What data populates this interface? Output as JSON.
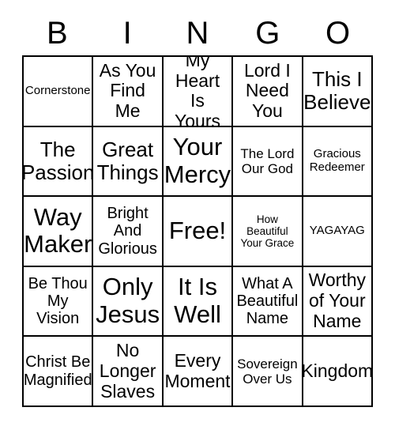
{
  "card": {
    "header_letters": [
      "B",
      "I",
      "N",
      "G",
      "O"
    ],
    "columns": 5,
    "rows": 5,
    "border_color": "#000000",
    "background_color": "#ffffff",
    "text_color": "#000000",
    "free_space": {
      "row": 3,
      "column": 3,
      "label": "Free!"
    },
    "cells": [
      {
        "label": "Cornerstone",
        "size": "xs"
      },
      {
        "label": "As You Find Me",
        "size": "lg"
      },
      {
        "label": "My Heart Is Yours",
        "size": "lg"
      },
      {
        "label": "Lord I Need You",
        "size": "lg"
      },
      {
        "label": "This I Believe",
        "size": "xl"
      },
      {
        "label": "The Passion",
        "size": "xl"
      },
      {
        "label": "Great Things",
        "size": "xl"
      },
      {
        "label": "Your Mercy",
        "size": "xxl"
      },
      {
        "label": "The Lord Our God",
        "size": "sm"
      },
      {
        "label": "Gracious Redeemer",
        "size": "xs"
      },
      {
        "label": "Way Maker",
        "size": "xxl"
      },
      {
        "label": "Bright And Glorious",
        "size": "md"
      },
      {
        "label": "Free!",
        "size": "xxl"
      },
      {
        "label": "How Beautiful Your Grace",
        "size": "xxs"
      },
      {
        "label": "YAGAYAG",
        "size": "xs"
      },
      {
        "label": "Be Thou My Vision",
        "size": "md"
      },
      {
        "label": "Only Jesus",
        "size": "xxl"
      },
      {
        "label": "It Is Well",
        "size": "xxl"
      },
      {
        "label": "What A Beautiful Name",
        "size": "md"
      },
      {
        "label": "Worthy of Your Name",
        "size": "lg"
      },
      {
        "label": "Christ Be Magnified",
        "size": "md"
      },
      {
        "label": "No Longer Slaves",
        "size": "lg"
      },
      {
        "label": "Every Moment",
        "size": "lg"
      },
      {
        "label": "Sovereign Over Us",
        "size": "sm"
      },
      {
        "label": "Kingdom",
        "size": "lg"
      }
    ]
  }
}
